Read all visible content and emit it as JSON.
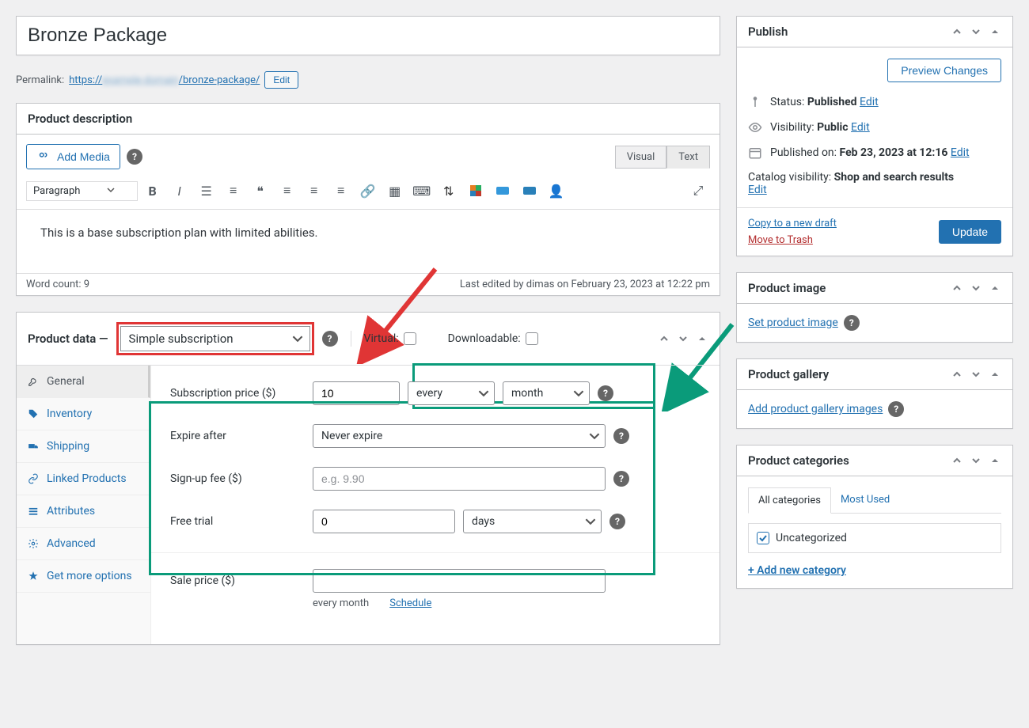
{
  "title": "Bronze Package",
  "permalink": {
    "label": "Permalink:",
    "prefix": "https://",
    "blurred": "example-domain",
    "suffix": "/bronze-package/",
    "edit_label": "Edit"
  },
  "description_panel": {
    "heading": "Product description",
    "add_media_label": "Add Media",
    "tabs": {
      "visual": "Visual",
      "text": "Text"
    },
    "paragraph_label": "Paragraph",
    "content": "This is a base subscription plan with limited abilities.",
    "word_count_label": "Word count: 9",
    "last_edited": "Last edited by dimas on February 23, 2023 at 12:22 pm"
  },
  "product_data": {
    "heading": "Product data —",
    "type_value": "Simple subscription",
    "virtual_label": "Virtual:",
    "downloadable_label": "Downloadable:",
    "tabs": {
      "general": "General",
      "inventory": "Inventory",
      "shipping": "Shipping",
      "linked": "Linked Products",
      "attributes": "Attributes",
      "advanced": "Advanced",
      "get_more": "Get more options"
    },
    "fields": {
      "price_label": "Subscription price ($)",
      "price_value": "10",
      "interval_value": "every",
      "period_value": "month",
      "expire_label": "Expire after",
      "expire_value": "Never expire",
      "signup_label": "Sign-up fee ($)",
      "signup_placeholder": "e.g. 9.90",
      "trial_label": "Free trial",
      "trial_value": "0",
      "trial_period": "days",
      "sale_label": "Sale price ($)",
      "sale_summary": "every month",
      "schedule_label": "Schedule"
    }
  },
  "publish": {
    "heading": "Publish",
    "preview_label": "Preview Changes",
    "status_label": "Status:",
    "status_value": "Published",
    "status_edit": "Edit",
    "visibility_label": "Visibility:",
    "visibility_value": "Public",
    "visibility_edit": "Edit",
    "published_label": "Published on:",
    "published_value": "Feb 23, 2023 at 12:16",
    "published_edit": "Edit",
    "catalog_label": "Catalog visibility:",
    "catalog_value": "Shop and search results",
    "catalog_edit": "Edit",
    "copy_label": "Copy to a new draft",
    "trash_label": "Move to Trash",
    "update_label": "Update"
  },
  "product_image": {
    "heading": "Product image",
    "link": "Set product image"
  },
  "product_gallery": {
    "heading": "Product gallery",
    "link": "Add product gallery images"
  },
  "categories": {
    "heading": "Product categories",
    "tabs": {
      "all": "All categories",
      "most": "Most Used"
    },
    "items": [
      "Uncategorized"
    ],
    "add_label": "+ Add new category"
  }
}
